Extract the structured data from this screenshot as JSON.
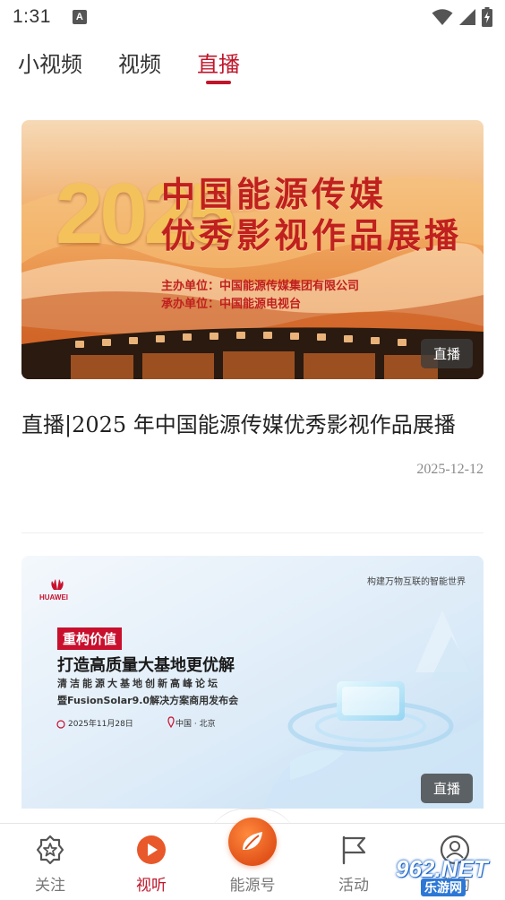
{
  "status_bar": {
    "time": "1:31",
    "notification_letter": "A"
  },
  "tabs": [
    {
      "label": "小视频",
      "active": false
    },
    {
      "label": "视频",
      "active": false
    },
    {
      "label": "直播",
      "active": true
    }
  ],
  "accent_color": "#c0162b",
  "cards": [
    {
      "thumbnail": {
        "year": "2025",
        "line1": "中国能源传媒",
        "line2": "优秀影视作品展播",
        "organizer": "主办单位：中国能源传媒集团有限公司",
        "co_organizer": "承办单位：中国能源电视台"
      },
      "badge": "直播",
      "title": "直播|2025 年中国能源传媒优秀影视作品展播",
      "date": "2025-12-12"
    },
    {
      "thumbnail": {
        "brand": "HUAWEI",
        "slogan": "构建万物互联的智能世界",
        "tag": "重构价值",
        "headline": "打造高质量大基地更优解",
        "sub1": "清洁能源大基地创新高峰论坛",
        "sub2": "暨FusionSolar9.0解决方案商用发布会",
        "date": "2025年11月28日",
        "location": "中国 · 北京"
      },
      "badge": "直播"
    }
  ],
  "bottom_nav": [
    {
      "label": "关注",
      "icon": "star-badge-icon",
      "active": false
    },
    {
      "label": "视听",
      "icon": "play-icon",
      "active": true
    },
    {
      "label": "能源号",
      "icon": "leaf-icon",
      "active": false
    },
    {
      "label": "活动",
      "icon": "flag-icon",
      "active": false
    },
    {
      "label": "我的",
      "icon": "user-icon",
      "active": false
    }
  ],
  "watermark": {
    "number": "962.NET",
    "site": "乐游网"
  }
}
